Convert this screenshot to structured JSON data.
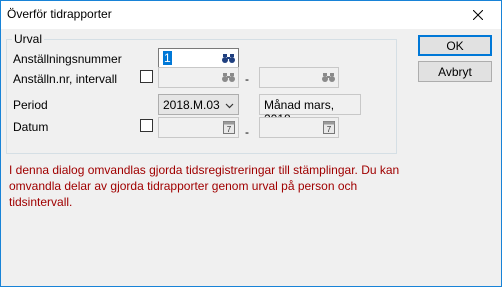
{
  "window": {
    "title": "Överför tidrapporter"
  },
  "group": {
    "legend": "Urval"
  },
  "fields": {
    "employee_number": {
      "label": "Anställningsnummer",
      "value": "1",
      "icon": "binoculars-icon"
    },
    "employee_interval": {
      "label": "Anställn.nr, intervall",
      "from": "",
      "to": "",
      "icon": "binoculars-icon",
      "checked": false
    },
    "period": {
      "label": "Period",
      "value": "2018.M.03",
      "description": "Månad mars, 2018"
    },
    "date": {
      "label": "Datum",
      "from": "",
      "to": "",
      "icon": "calendar-icon",
      "checked": false
    },
    "dash": "-"
  },
  "info": {
    "text": "I denna dialog omvandlas gjorda tidsregistreringar till stämplingar. Du kan omvandla delar av gjorda tidrapporter genom urval på person och tidsintervall."
  },
  "buttons": {
    "ok": "OK",
    "cancel": "Avbryt"
  },
  "colors": {
    "info_text": "#a00000",
    "accent": "#0078d7"
  }
}
